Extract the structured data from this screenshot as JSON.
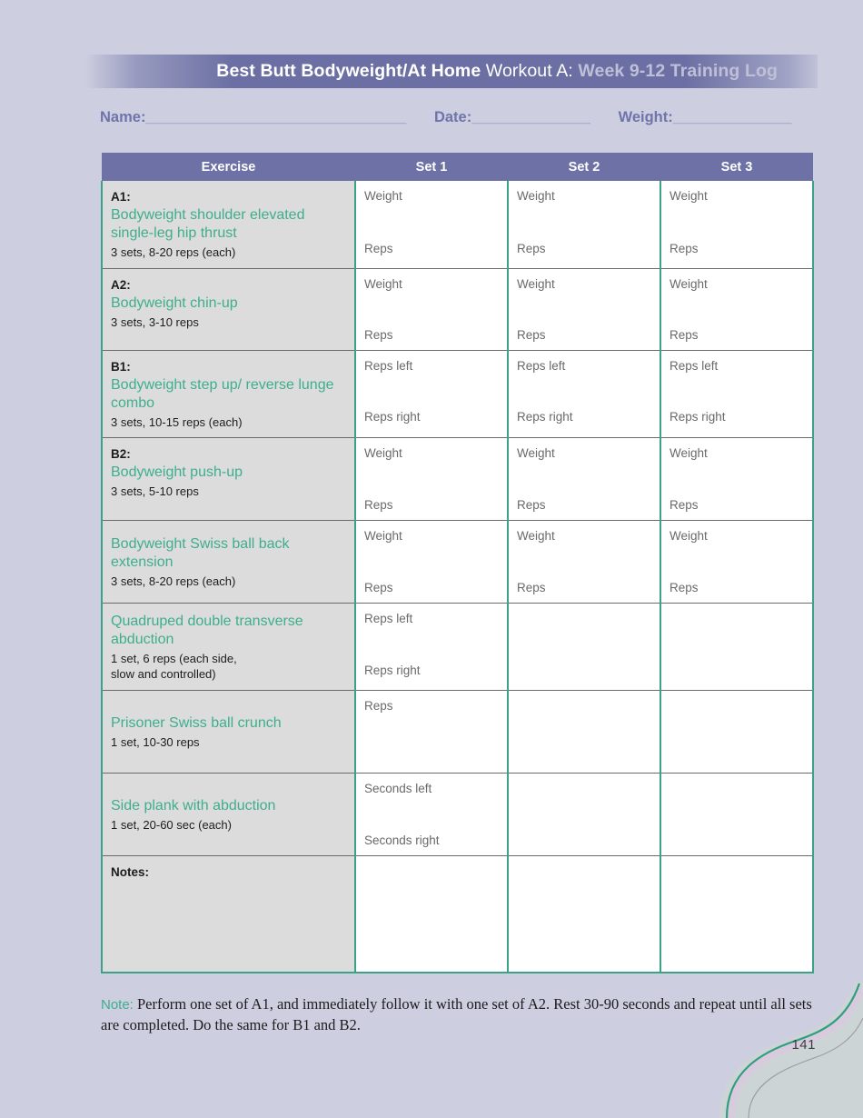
{
  "header": {
    "title_bold": "Best Butt Bodyweight/At Home",
    "title_regular": "Workout A:",
    "title_light": "Week 9-12 Training Log",
    "accent_purple": "#6b6fa3",
    "accent_teal": "#3eae8d",
    "page_background": "#cdcee0"
  },
  "info": {
    "name_label": "Name:",
    "name_rule": "_________________________________",
    "date_label": "Date:",
    "date_rule": "_______________",
    "weight_label": "Weight:",
    "weight_rule": "_______________"
  },
  "table": {
    "columns": [
      "Exercise",
      "Set 1",
      "Set 2",
      "Set 3"
    ],
    "rows": [
      {
        "tag": "A1:",
        "name": "Bodyweight shoulder elevated single-leg hip thrust",
        "detail": "3 sets, 8-20 reps (each)",
        "sets": [
          {
            "top": "Weight",
            "bottom": "Reps"
          },
          {
            "top": "Weight",
            "bottom": "Reps"
          },
          {
            "top": "Weight",
            "bottom": "Reps"
          }
        ],
        "height": 92
      },
      {
        "tag": "A2:",
        "name": "Bodyweight chin-up",
        "detail": "3 sets, 3-10 reps",
        "sets": [
          {
            "top": "Weight",
            "bottom": "Reps"
          },
          {
            "top": "Weight",
            "bottom": "Reps"
          },
          {
            "top": "Weight",
            "bottom": "Reps"
          }
        ],
        "height": 90
      },
      {
        "tag": "B1:",
        "name": "Bodyweight step up/ reverse lunge combo",
        "detail": "3 sets, 10-15 reps (each)",
        "sets": [
          {
            "top": "Reps left",
            "bottom": "Reps right"
          },
          {
            "top": "Reps left",
            "bottom": "Reps right"
          },
          {
            "top": "Reps left",
            "bottom": "Reps right"
          }
        ],
        "height": 90
      },
      {
        "tag": "B2:",
        "name": "Bodyweight push-up",
        "detail": "3 sets, 5-10 reps",
        "sets": [
          {
            "top": "Weight",
            "bottom": "Reps"
          },
          {
            "top": "Weight",
            "bottom": "Reps"
          },
          {
            "top": "Weight",
            "bottom": "Reps"
          }
        ],
        "height": 91
      },
      {
        "tag": "",
        "name": "Bodyweight Swiss ball back extension",
        "detail": "3 sets, 8-20 reps (each)",
        "sets": [
          {
            "top": "Weight",
            "bottom": "Reps"
          },
          {
            "top": "Weight",
            "bottom": "Reps"
          },
          {
            "top": "Weight",
            "bottom": "Reps"
          }
        ],
        "height": 91
      },
      {
        "tag": "",
        "name": "Quadruped double transverse abduction",
        "detail": "1 set, 6 reps (each side,\nslow and controlled)",
        "sets": [
          {
            "top": "Reps left",
            "bottom": "Reps right"
          },
          {
            "top": "",
            "bottom": ""
          },
          {
            "top": "",
            "bottom": ""
          }
        ],
        "height": 91
      },
      {
        "tag": "",
        "name": "Prisoner Swiss ball crunch",
        "detail": "1 set, 10-30 reps",
        "sets": [
          {
            "top": "Reps",
            "bottom": ""
          },
          {
            "top": "",
            "bottom": ""
          },
          {
            "top": "",
            "bottom": ""
          }
        ],
        "height": 91
      },
      {
        "tag": "",
        "name": "Side plank with abduction",
        "detail": "1 set, 20-60 sec (each)",
        "sets": [
          {
            "top": "Seconds left",
            "bottom": "Seconds right"
          },
          {
            "top": "",
            "bottom": ""
          },
          {
            "top": "",
            "bottom": ""
          }
        ],
        "height": 91
      },
      {
        "tag": "Notes:",
        "name": "",
        "detail": "",
        "sets": [
          {
            "top": "",
            "bottom": ""
          },
          {
            "top": "",
            "bottom": ""
          },
          {
            "top": "",
            "bottom": ""
          }
        ],
        "height": 128
      }
    ]
  },
  "footer": {
    "note_label": "Note:",
    "note_text": " Perform one set of A1, and immediately follow it with one set of A2. Rest 30-90 seconds and repeat until all sets are completed. Do the same for B1 and B2."
  },
  "page_number": "141"
}
